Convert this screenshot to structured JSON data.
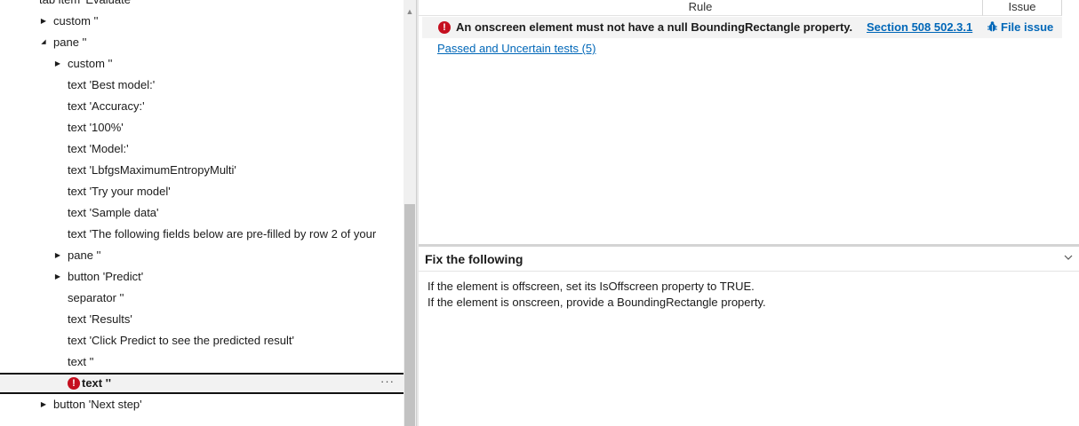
{
  "tree": {
    "rows": [
      {
        "label": "tab item 'Evaluate'",
        "expander": "",
        "level": 0
      },
      {
        "label": "custom ''",
        "expander": "collapsed",
        "level": 1
      },
      {
        "label": "pane ''",
        "expander": "expanded",
        "level": 1
      },
      {
        "label": "custom ''",
        "expander": "collapsed",
        "level": 2
      },
      {
        "label": "text 'Best model:'",
        "expander": "",
        "level": 2
      },
      {
        "label": "text 'Accuracy:'",
        "expander": "",
        "level": 2
      },
      {
        "label": "text '100%'",
        "expander": "",
        "level": 2
      },
      {
        "label": "text 'Model:'",
        "expander": "",
        "level": 2
      },
      {
        "label": "text 'LbfgsMaximumEntropyMulti'",
        "expander": "",
        "level": 2
      },
      {
        "label": "text 'Try your model'",
        "expander": "",
        "level": 2
      },
      {
        "label": "text 'Sample data'",
        "expander": "",
        "level": 2
      },
      {
        "label": "text 'The following fields below are pre-filled by row 2 of your",
        "expander": "",
        "level": 2
      },
      {
        "label": "pane ''",
        "expander": "collapsed",
        "level": 2
      },
      {
        "label": "button 'Predict'",
        "expander": "collapsed",
        "level": 2
      },
      {
        "label": "separator ''",
        "expander": "",
        "level": 2
      },
      {
        "label": "text 'Results'",
        "expander": "",
        "level": 2
      },
      {
        "label": "text 'Click Predict to see the predicted result'",
        "expander": "",
        "level": 2
      },
      {
        "label": "text ''",
        "expander": "",
        "level": 2
      },
      {
        "label": "text ''",
        "expander": "",
        "level": 2,
        "selected": true,
        "error": true
      },
      {
        "label": "button 'Next step'",
        "expander": "collapsed",
        "level": 1
      }
    ],
    "more_label": "···",
    "error_glyph": "!"
  },
  "results": {
    "columns": {
      "rule": "Rule",
      "issue": "Issue"
    },
    "row": {
      "error_glyph": "!",
      "message": "An onscreen element must not have a null BoundingRectangle property.",
      "link": "Section 508 502.3.1",
      "file_issue": "File issue"
    },
    "passed_link": "Passed and Uncertain tests (5)"
  },
  "fix": {
    "title": "Fix the following",
    "lines": [
      "If the element is offscreen, set its IsOffscreen property to TRUE.",
      "If the element is onscreen, provide a BoundingRectangle property."
    ]
  },
  "colors": {
    "error": "#c50f1f",
    "link": "#0067b8",
    "selection_bg": "#f2f2f2"
  }
}
